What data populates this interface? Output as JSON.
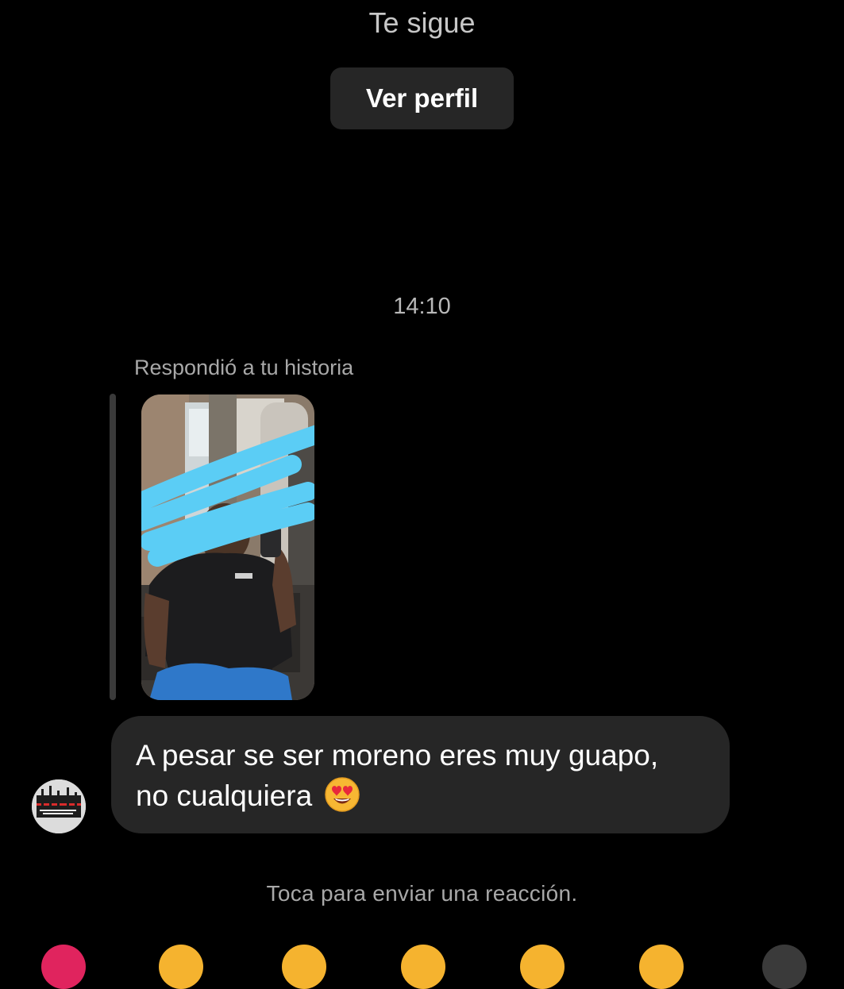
{
  "header": {
    "follows_text": "Te sigue",
    "view_profile_label": "Ver perfil"
  },
  "conversation": {
    "timestamp": "14:10",
    "story_reply_label": "Respondió a tu historia",
    "message": {
      "line1": "A pesar se ser moreno eres muy guapo,",
      "line2": "no cualquiera",
      "emoji": "heart-eyes-emoji"
    }
  },
  "footer": {
    "reaction_hint": "Toca para enviar una reacción."
  },
  "colors": {
    "background": "#000000",
    "bubble": "#262626",
    "secondary_text": "#a8a8a8",
    "scribble": "#5bcdf5"
  }
}
